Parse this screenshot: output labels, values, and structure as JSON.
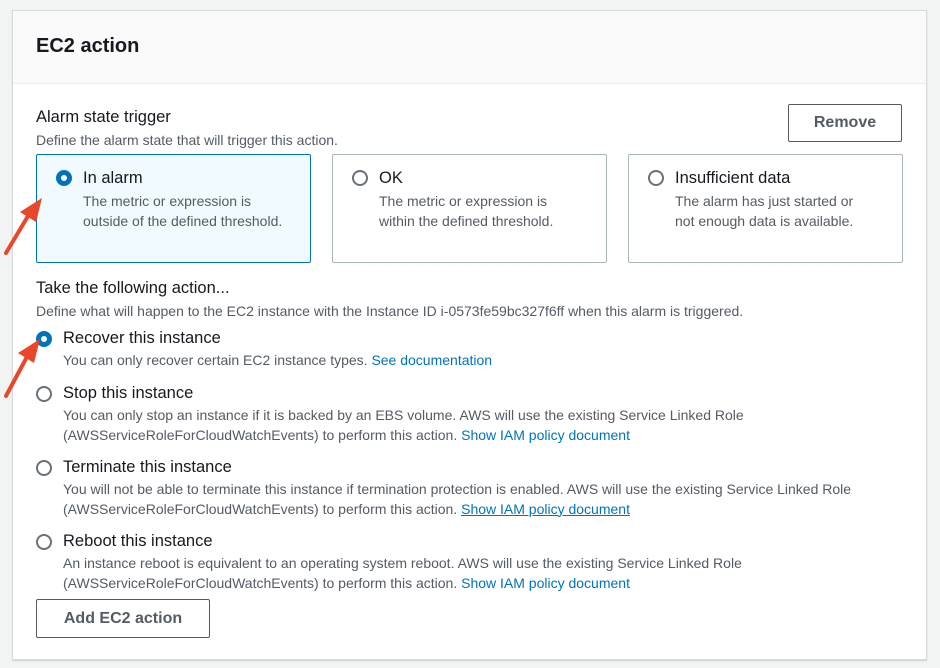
{
  "panel": {
    "title": "EC2 action"
  },
  "trigger": {
    "title": "Alarm state trigger",
    "description": "Define the alarm state that will trigger this action.",
    "remove_label": "Remove",
    "options": [
      {
        "label": "In alarm",
        "description": "The metric or expression is outside of the defined threshold.",
        "selected": true
      },
      {
        "label": "OK",
        "description": "The metric or expression is within the defined threshold.",
        "selected": false
      },
      {
        "label": "Insufficient data",
        "description": "The alarm has just started or not enough data is available.",
        "selected": false
      }
    ]
  },
  "action": {
    "title": "Take the following action...",
    "description": "Define what will happen to the EC2 instance with the Instance ID i-0573fe59bc327f6ff when this alarm is triggered.",
    "options": [
      {
        "label": "Recover this instance",
        "desc_text": "You can only recover certain EC2 instance types. ",
        "desc_link": "See documentation",
        "selected": true
      },
      {
        "label": "Stop this instance",
        "desc_text": "You can only stop an instance if it is backed by an EBS volume. AWS will use the existing Service Linked Role (AWSServiceRoleForCloudWatchEvents) to perform this action. ",
        "desc_link": "Show IAM policy document",
        "selected": false
      },
      {
        "label": "Terminate this instance",
        "desc_text": "You will not be able to terminate this instance if termination protection is enabled. AWS will use the existing Service Linked Role (AWSServiceRoleForCloudWatchEvents) to perform this action. ",
        "desc_link": "Show IAM policy document",
        "selected": false
      },
      {
        "label": "Reboot this instance",
        "desc_text": "An instance reboot is equivalent to an operating system reboot. AWS will use the existing Service Linked Role (AWSServiceRoleForCloudWatchEvents) to perform this action. ",
        "desc_link": "Show IAM policy document",
        "selected": false
      }
    ]
  },
  "add_button_label": "Add EC2 action",
  "colors": {
    "accent": "#0073bb",
    "annotation_arrow": "#e8472b"
  }
}
